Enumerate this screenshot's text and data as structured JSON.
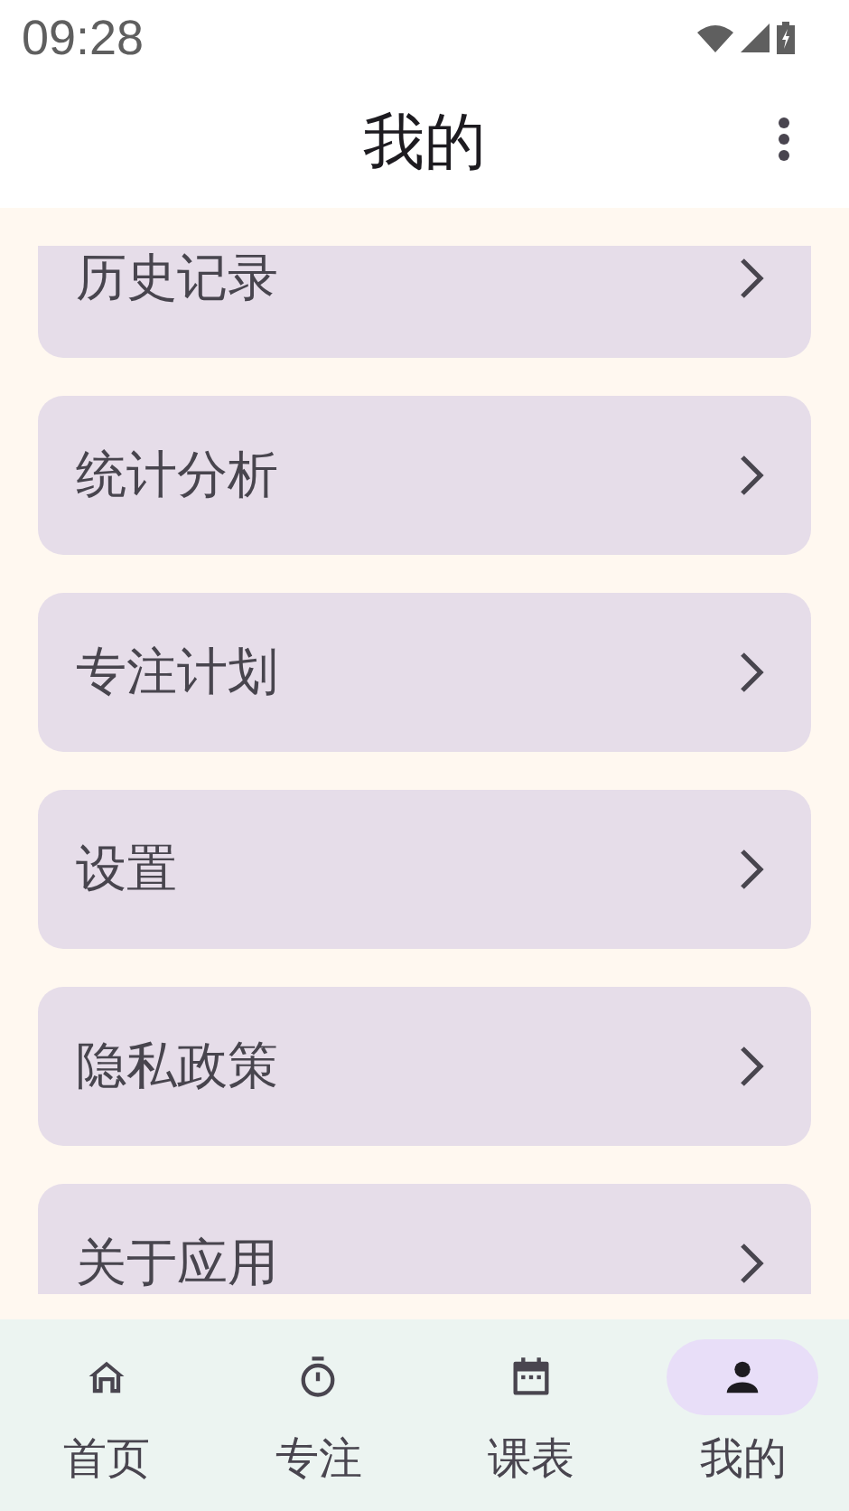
{
  "status_bar": {
    "time": "09:28"
  },
  "app_bar": {
    "title": "我的"
  },
  "menu_items": [
    {
      "label": "历史记录"
    },
    {
      "label": "统计分析"
    },
    {
      "label": "专注计划"
    },
    {
      "label": "设置"
    },
    {
      "label": "隐私政策"
    },
    {
      "label": "关于应用"
    }
  ],
  "bottom_nav": [
    {
      "label": "首页",
      "kind": "home",
      "selected": false
    },
    {
      "label": "专注",
      "kind": "timer",
      "selected": false
    },
    {
      "label": "课表",
      "kind": "calendar",
      "selected": false
    },
    {
      "label": "我的",
      "kind": "person",
      "selected": true
    }
  ]
}
